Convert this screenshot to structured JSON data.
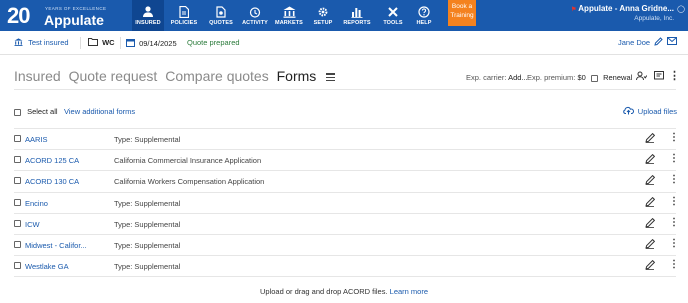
{
  "header": {
    "logo_years": "YEARS OF EXCELLENCE",
    "logo_number": "20",
    "brand": "Appulate",
    "nav": [
      {
        "label": "INSURED",
        "icon": "person-icon",
        "active": true
      },
      {
        "label": "POLICIES",
        "icon": "document-icon",
        "active": false
      },
      {
        "label": "QUOTES",
        "icon": "quotes-icon",
        "active": false
      },
      {
        "label": "ACTIVITY",
        "icon": "activity-icon",
        "active": false
      },
      {
        "label": "MARKETS",
        "icon": "bank-icon",
        "active": false
      },
      {
        "label": "SETUP",
        "icon": "gear-icon",
        "active": false
      },
      {
        "label": "REPORTS",
        "icon": "bar-chart-icon",
        "active": false
      },
      {
        "label": "TOOLS",
        "icon": "tools-icon",
        "active": false
      },
      {
        "label": "HELP",
        "icon": "help-icon",
        "active": false
      }
    ],
    "book_training": "Book a Training",
    "user_name": "Appulate - Anna Gridne...",
    "company": "Appulate, Inc.",
    "accent": "#1a5aad",
    "training_color": "#f4821f"
  },
  "subbar": {
    "insured": "Test insured",
    "line": "WC",
    "date": "09/14/2025",
    "status": "Quote prepared",
    "user": "Jane Doe"
  },
  "tabs": {
    "insured": "Insured",
    "quote_request": "Quote request",
    "compare_quotes": "Compare quotes",
    "forms": "Forms"
  },
  "info": {
    "carrier_label": "Exp. carrier:",
    "carrier_value": "Add...",
    "premium_label": "Exp. premium:",
    "premium_value": "$0",
    "renewal": "Renewal"
  },
  "actions": {
    "select_all": "Select all",
    "view_additional": "View additional forms",
    "upload": "Upload files"
  },
  "forms": [
    {
      "name": "AARIS",
      "type": "Type: Supplemental"
    },
    {
      "name": "ACORD 125 CA",
      "type": "California Commercial Insurance Application"
    },
    {
      "name": "ACORD 130 CA",
      "type": "California Workers Compensation Application"
    },
    {
      "name": "Encino",
      "type": "Type: Supplemental"
    },
    {
      "name": "ICW",
      "type": "Type: Supplemental"
    },
    {
      "name": "Midwest - Califor...",
      "type": "Type: Supplemental"
    },
    {
      "name": "Westlake GA",
      "type": "Type: Supplemental"
    }
  ],
  "footer": {
    "text": "Upload or drag and drop ACORD files.",
    "link": "Learn more"
  }
}
